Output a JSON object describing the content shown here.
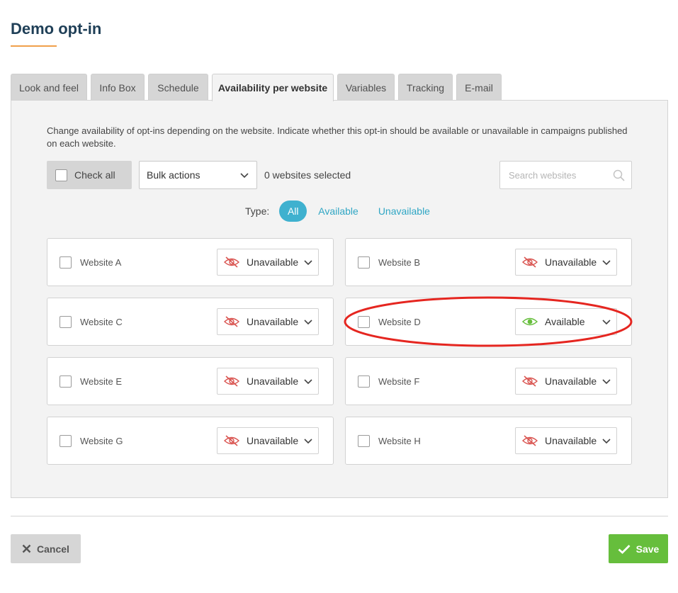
{
  "page": {
    "title": "Demo opt-in"
  },
  "tabs": [
    {
      "label": "Look and feel",
      "active": false
    },
    {
      "label": "Info Box",
      "active": false
    },
    {
      "label": "Schedule",
      "active": false
    },
    {
      "label": "Availability per website",
      "active": true
    },
    {
      "label": "Variables",
      "active": false
    },
    {
      "label": "Tracking",
      "active": false
    },
    {
      "label": "E-mail",
      "active": false
    }
  ],
  "panel": {
    "description": "Change availability of opt-ins depending on the website. Indicate whether this opt-in should be available or unavailable in campaigns published on each website."
  },
  "toolbar": {
    "check_all_label": "Check all",
    "bulk_actions_label": "Bulk actions",
    "selected_count": "0 websites selected",
    "search_placeholder": "Search websites"
  },
  "type_filter": {
    "label": "Type:",
    "options": [
      {
        "label": "All",
        "active": true
      },
      {
        "label": "Available",
        "active": false
      },
      {
        "label": "Unavailable",
        "active": false
      }
    ]
  },
  "websites": [
    {
      "name": "Website A",
      "status": "Unavailable"
    },
    {
      "name": "Website B",
      "status": "Unavailable"
    },
    {
      "name": "Website C",
      "status": "Unavailable"
    },
    {
      "name": "Website D",
      "status": "Available"
    },
    {
      "name": "Website E",
      "status": "Unavailable"
    },
    {
      "name": "Website F",
      "status": "Unavailable"
    },
    {
      "name": "Website G",
      "status": "Unavailable"
    },
    {
      "name": "Website H",
      "status": "Unavailable"
    }
  ],
  "footer": {
    "cancel_label": "Cancel",
    "save_label": "Save"
  },
  "colors": {
    "title": "#1f3f57",
    "accent_underline": "#f0a04b",
    "filter_active": "#3fb1cf",
    "filter_link": "#2fa6c4",
    "unavailable_icon": "#d9534f",
    "available_icon": "#66be3c",
    "save_button": "#66be3c",
    "highlight_ellipse": "#e52620"
  },
  "icons": {
    "unavailable": "eye-slash-icon",
    "available": "eye-icon",
    "search": "search-icon",
    "dropdown": "chevron-down-icon",
    "cancel": "close-icon",
    "save": "checkmark-icon"
  }
}
